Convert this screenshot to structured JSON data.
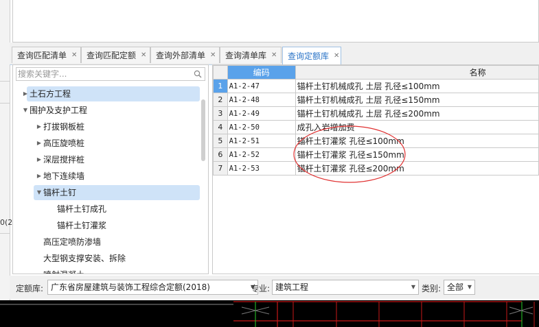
{
  "left_fragment": "0(2",
  "tabs": [
    {
      "label": "查询匹配清单"
    },
    {
      "label": "查询匹配定额"
    },
    {
      "label": "查询外部清单"
    },
    {
      "label": "查询清单库"
    },
    {
      "label": "查询定额库",
      "active": true
    }
  ],
  "search": {
    "placeholder": "搜索关键字..."
  },
  "tree": [
    {
      "label": "土石方工程"
    },
    {
      "label": "围护及支护工程"
    },
    {
      "label": "打拔钢板桩"
    },
    {
      "label": "高压旋喷桩"
    },
    {
      "label": "深层搅拌桩"
    },
    {
      "label": "地下连续墙"
    },
    {
      "label": "锚杆土钉"
    },
    {
      "label": "锚杆土钉成孔"
    },
    {
      "label": "锚杆土钉灌浆"
    },
    {
      "label": "高压定喷防渗墙"
    },
    {
      "label": "大型钢支撑安装、拆除"
    },
    {
      "label": "喷射混凝土"
    }
  ],
  "grid": {
    "headers": {
      "code": "编码",
      "name": "名称"
    },
    "rows": [
      {
        "num": "1",
        "code": "A1-2-47",
        "name": "锚杆土钉机械成孔 土层 孔径≤100mm"
      },
      {
        "num": "2",
        "code": "A1-2-48",
        "name": "锚杆土钉机械成孔 土层 孔径≤150mm"
      },
      {
        "num": "3",
        "code": "A1-2-49",
        "name": "锚杆土钉机械成孔 土层 孔径≤200mm"
      },
      {
        "num": "4",
        "code": "A1-2-50",
        "name": "成孔入岩增加费"
      },
      {
        "num": "5",
        "code": "A1-2-51",
        "name": "锚杆土钉灌浆 孔径≤100mm"
      },
      {
        "num": "6",
        "code": "A1-2-52",
        "name": "锚杆土钉灌浆 孔径≤150mm"
      },
      {
        "num": "7",
        "code": "A1-2-53",
        "name": "锚杆土钉灌浆 孔径≤200mm"
      }
    ]
  },
  "bottom": {
    "quota_label": "定额库:",
    "quota_value": "广东省房屋建筑与装饰工程综合定额(2018)",
    "major_label": "专业:",
    "major_value": "建筑工程",
    "category_label": "类别:",
    "category_value": "全部"
  },
  "colors": {
    "accent": "#5aa2ea",
    "highlight": "#cfe3f8",
    "annotation": "#e03030"
  }
}
